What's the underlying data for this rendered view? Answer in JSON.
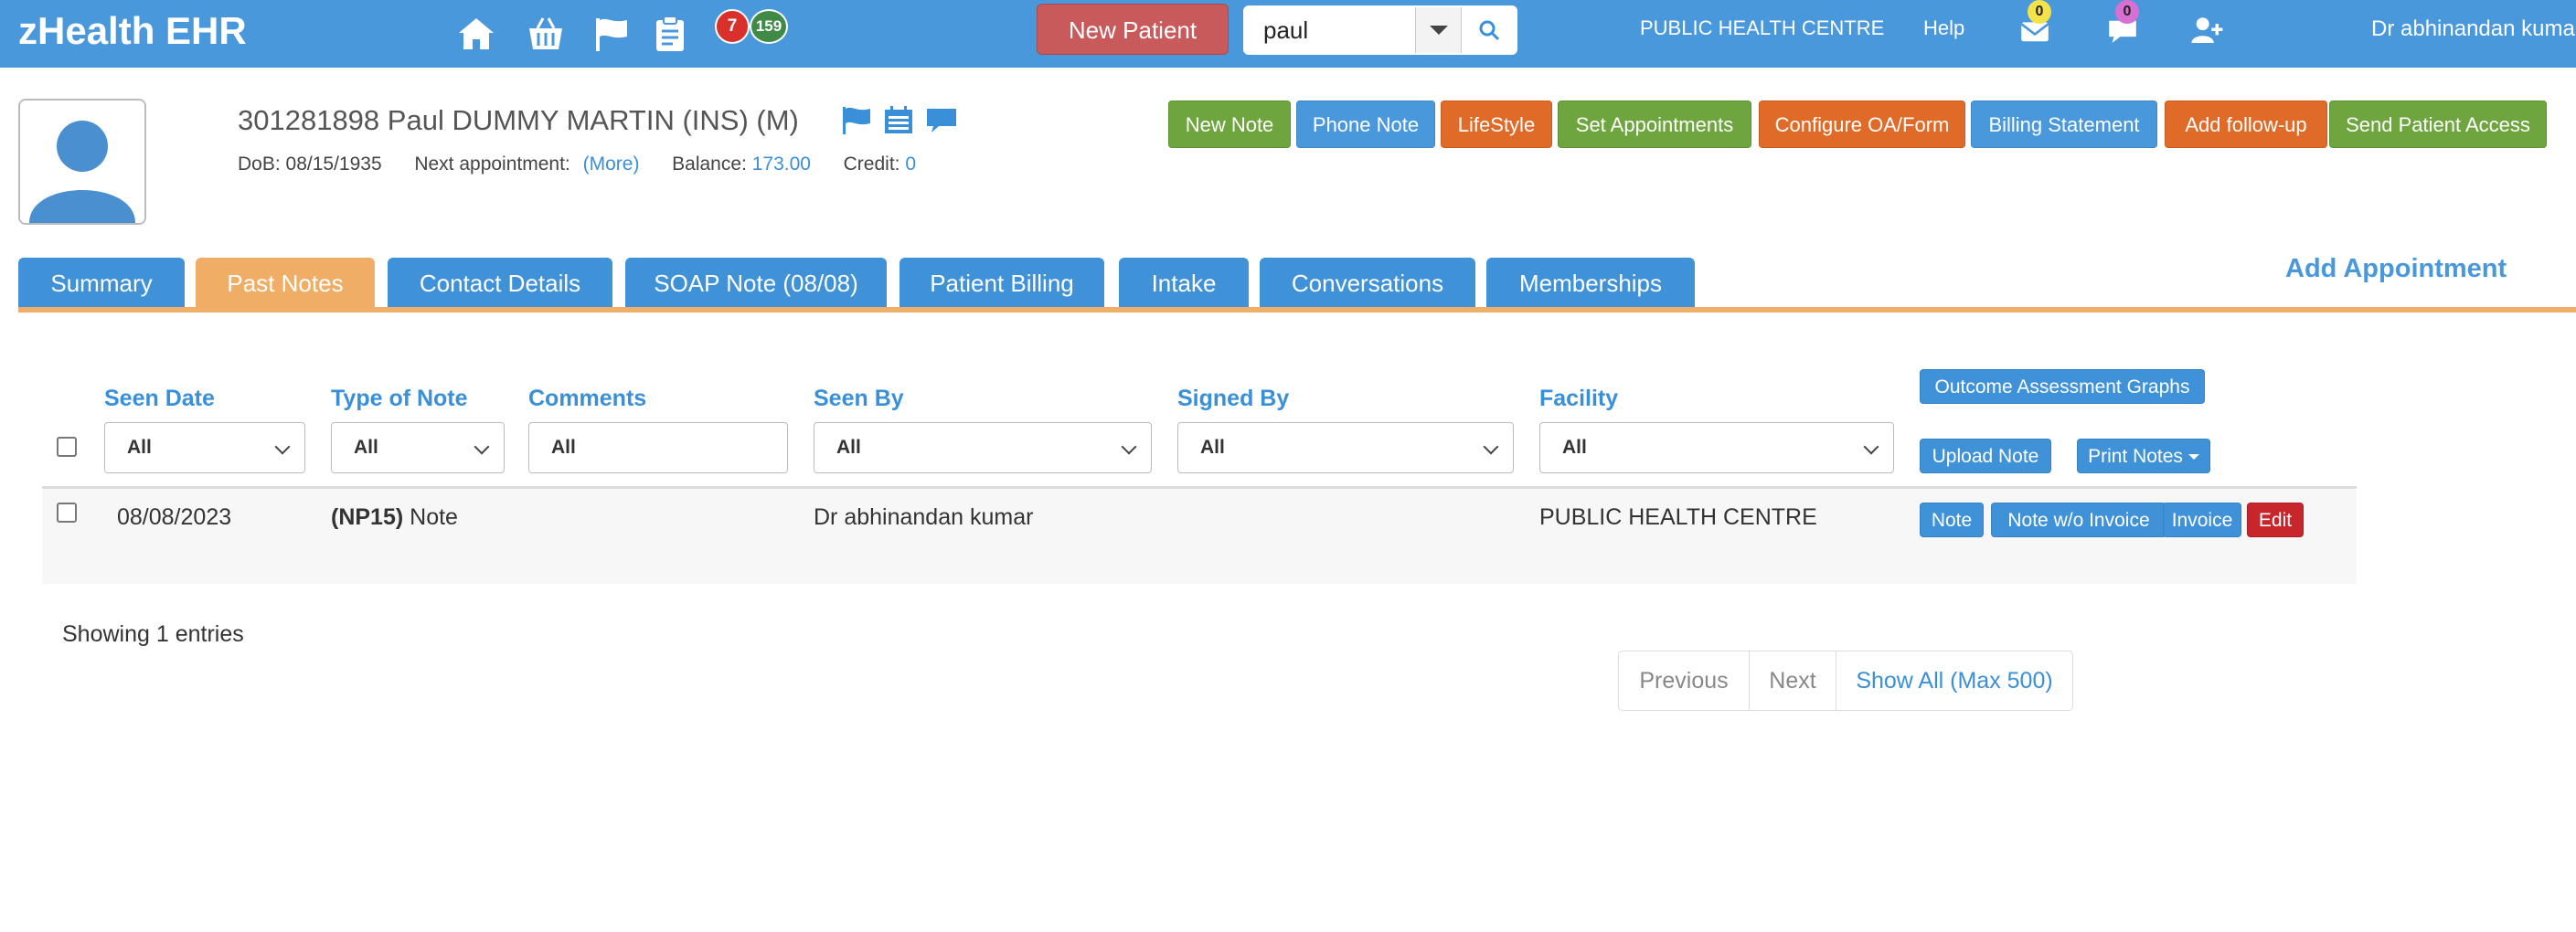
{
  "app": {
    "title": "zHealth EHR"
  },
  "nav": {
    "badges": {
      "flags_count": "7",
      "tasks_count": "159",
      "mail_count": "0",
      "chat_count": "0"
    },
    "new_patient_label": "New Patient",
    "search": {
      "value": "paul"
    },
    "facility": "PUBLIC HEALTH CENTRE",
    "help": "Help",
    "user": "Dr abhinandan kumar",
    "icons": [
      "home-icon",
      "basket-icon",
      "flag-icon",
      "clipboard-icon",
      "envelope-icon",
      "chat-icon",
      "user-plus-icon",
      "search-icon"
    ]
  },
  "patient": {
    "title": "301281898 Paul DUMMY MARTIN  (INS) (M)",
    "dob_label": "DoB:",
    "dob": "08/15/1935",
    "next_appt_label": "Next appointment:",
    "more_link": "(More)",
    "balance_label": "Balance:",
    "balance": "173.00",
    "credit_label": "Credit:",
    "credit": "0"
  },
  "actions": {
    "new_note": "New Note",
    "phone_note": "Phone Note",
    "lifestyle": "LifeStyle",
    "set_appointments": "Set Appointments",
    "configure_oa": "Configure OA/Form",
    "billing_statement": "Billing Statement",
    "add_followup": "Add follow-up",
    "send_patient_access": "Send Patient Access"
  },
  "tabs": [
    "Summary",
    "Past Notes",
    "Contact Details",
    "SOAP Note (08/08)",
    "Patient Billing",
    "Intake",
    "Conversations",
    "Memberships"
  ],
  "active_tab": "Past Notes",
  "add_appointment": "Add Appointment",
  "table": {
    "columns": [
      "Seen Date",
      "Type of Note",
      "Comments",
      "Seen By",
      "Signed By",
      "Facility"
    ],
    "filters": {
      "seen_date": "All",
      "type_of_note": "All",
      "comments": "All",
      "seen_by": "All",
      "signed_by": "All",
      "facility": "All"
    },
    "tools": {
      "outcome_graphs": "Outcome Assessment Graphs",
      "upload_note": "Upload Note",
      "print_notes": "Print Notes"
    },
    "rows": [
      {
        "seen_date": "08/08/2023",
        "note_code": "(NP15)",
        "note_type": "Note",
        "comments": "",
        "seen_by": "Dr abhinandan kumar",
        "signed_by": "",
        "facility": "PUBLIC HEALTH CENTRE",
        "buttons": {
          "note": "Note",
          "note_wo_invoice": "Note w/o Invoice",
          "invoice": "Invoice",
          "edit": "Edit"
        }
      }
    ]
  },
  "footer": {
    "showing": "Showing 1 entries",
    "pager": {
      "previous": "Previous",
      "next": "Next",
      "show_all": "Show All (Max 500)"
    }
  },
  "colors": {
    "navbar": "#4a98dc",
    "active_tab": "#f0ad65",
    "link": "#3a8fd9",
    "green": "#6fa53e",
    "orange": "#e06a27",
    "red": "#c7262b"
  }
}
